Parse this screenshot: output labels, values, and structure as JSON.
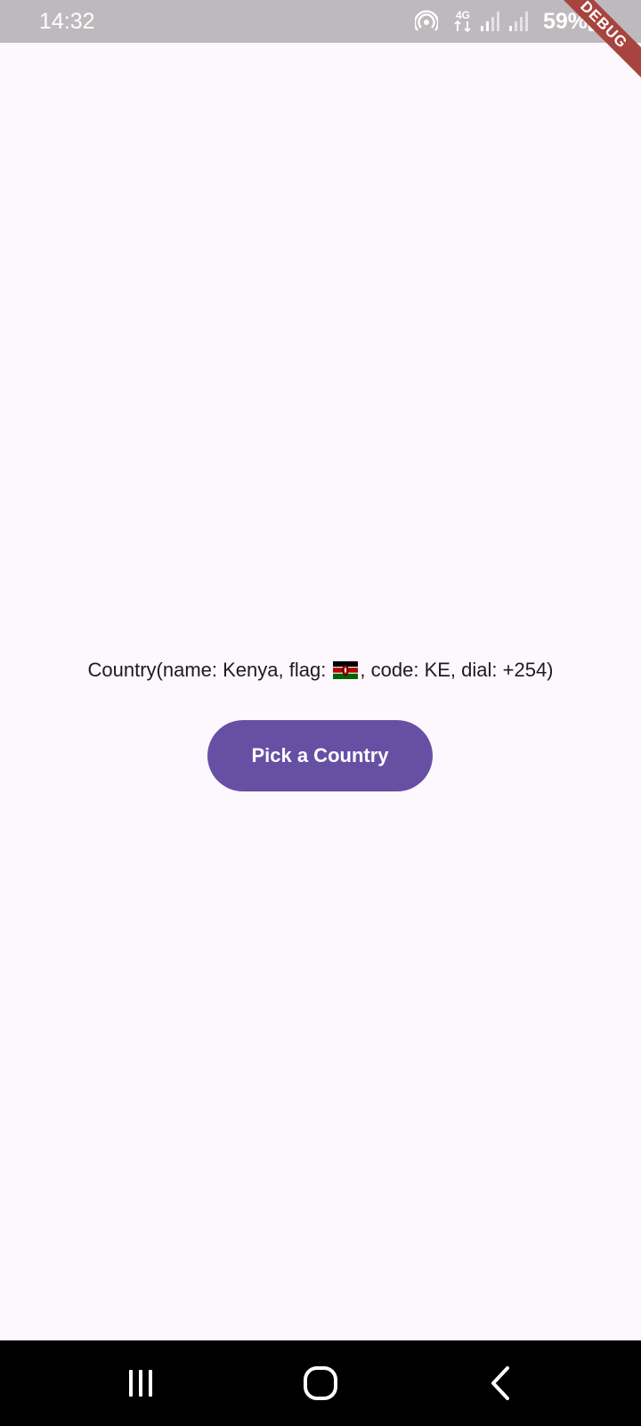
{
  "status_bar": {
    "time": "14:32",
    "network": "4G",
    "battery": "59%",
    "icons": [
      "hotspot-icon",
      "4g-data-icon",
      "signal-icon",
      "signal-icon",
      "battery-icon"
    ]
  },
  "debug_banner": "DEBUG",
  "main": {
    "country_prefix": "Country(name: Kenya, flag: ",
    "country_suffix": ", code: KE, dial: +254)",
    "flag_icon": "kenya-flag-icon",
    "pick_button_label": "Pick a Country"
  },
  "nav_bar": {
    "items": [
      "recent-apps-icon",
      "home-icon",
      "back-icon"
    ]
  },
  "colors": {
    "background": "#fdf7fe",
    "status_bar": "#bdb9bd",
    "primary": "#6750a4",
    "debug_banner": "#a8443f",
    "nav_bar": "#000000"
  }
}
